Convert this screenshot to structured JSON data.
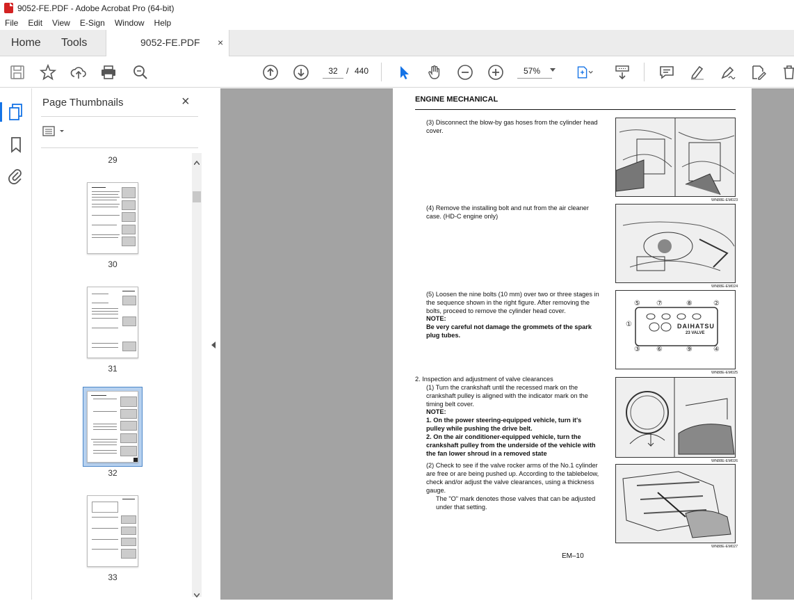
{
  "window": {
    "title": "9052-FE.PDF - Adobe Acrobat Pro (64-bit)"
  },
  "menu": [
    "File",
    "Edit",
    "View",
    "E-Sign",
    "Window",
    "Help"
  ],
  "tabs": {
    "home": "Home",
    "tools": "Tools",
    "document": "9052-FE.PDF",
    "close_glyph": "×"
  },
  "toolbar": {
    "page_current": "32",
    "page_separator": "/",
    "page_total": "440",
    "zoom": "57%"
  },
  "thumbnails": {
    "panel_title": "Page Thumbnails",
    "close_glyph": "×",
    "pages": [
      "29",
      "30",
      "31",
      "32",
      "33"
    ],
    "selected_page": "32"
  },
  "document": {
    "header": "ENGINE MECHANICAL",
    "steps": {
      "s3": "(3) Disconnect the blow-by gas hoses from the cylinder head cover.",
      "s4": "(4) Remove the installing bolt and nut from the air cleaner case. (HD-C engine only)",
      "s5": "(5) Loosen the nine bolts (10 mm) over two or three stages in the sequence shown in the right figure. After removing the bolts, proceed to remove the cylinder head cover.",
      "s5_note_label": "NOTE:",
      "s5_note": "Be very careful not damage the grommets of the spark plug tubes.",
      "s2_title": "2.  Inspection and adjustment of valve clearances",
      "s2_1": "(1) Turn the crankshaft until the recessed mark on the crankshaft pulley is aligned with the indicator mark on the timing belt cover.",
      "s2_note_label": "NOTE:",
      "s2_note_1": "1.  On the power steering-equipped vehicle, turn it's pulley while pushing the drive belt.",
      "s2_note_2": "2.  On the air conditioner-equipped vehicle, turn the crankshaft pulley from the underside of the vehicle with the fan lower shroud in a removed state",
      "s2_2": "(2) Check to see if the valve rocker arms of the No.1 cylinder are free or are being pushed up. According to the tablebelow, check and/or adjust the valve clearances, using a thickness gauge.",
      "s2_2b": "The \"O\" mark denotes those valves that can be adjusted under that setting."
    },
    "captions": [
      "WN88E-EM023",
      "WN88E-EM024",
      "WN88E-EM025",
      "WN88E-EM026",
      "WN88E-EM027"
    ],
    "cover_text_1": "DAIHATSU",
    "cover_text_2": "23 VALVE",
    "bolt_marks": [
      "⑤",
      "⑦",
      "⑧",
      "②",
      "①",
      "③",
      "⑥",
      "⑨",
      "④"
    ],
    "footer": "EM–10"
  },
  "colors": {
    "accent": "#1473e6",
    "selection": "#b7d1ef",
    "doc_bg": "#a3a3a3",
    "pdf_red": "#d32222"
  }
}
